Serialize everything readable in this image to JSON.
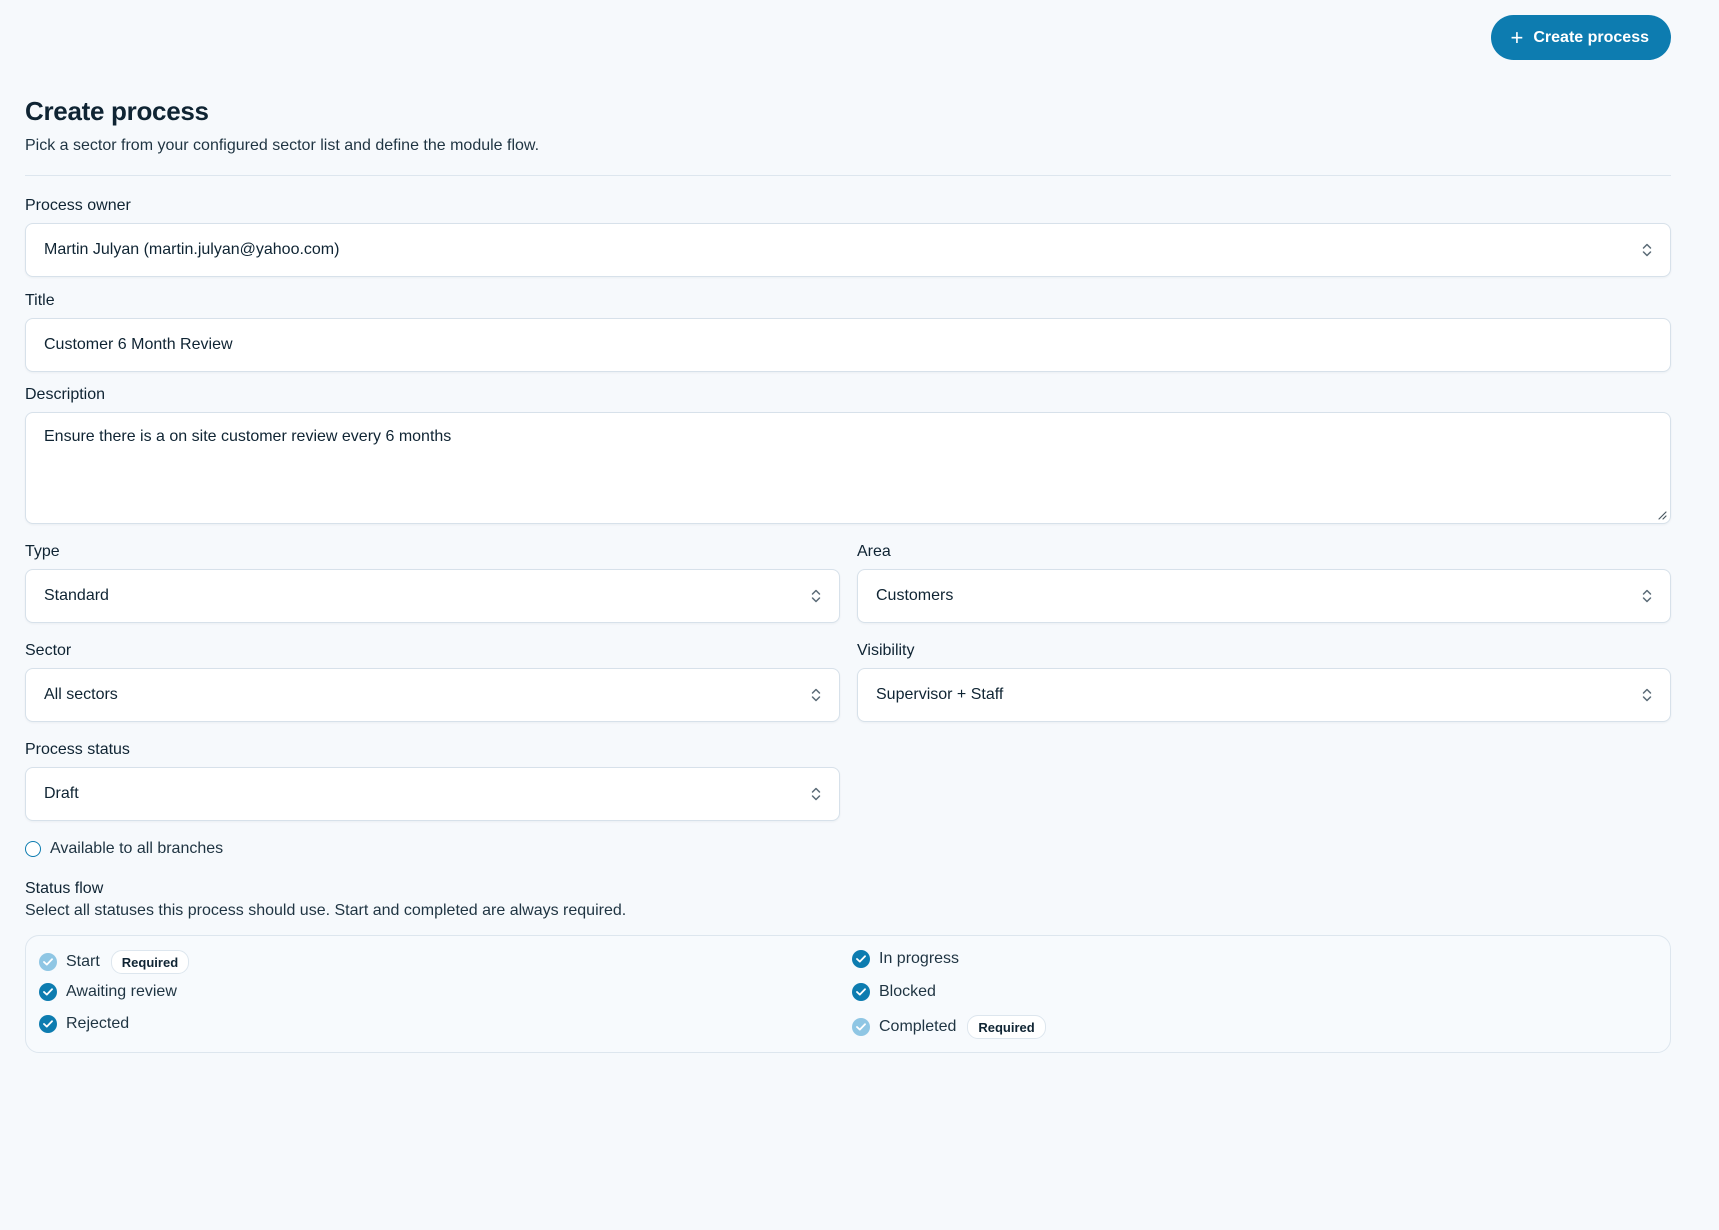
{
  "header": {
    "create_button_label": "Create process"
  },
  "page": {
    "title": "Create process",
    "subtitle": "Pick a sector from your configured sector list and define the module flow."
  },
  "form": {
    "process_owner": {
      "label": "Process owner",
      "value": "Martin Julyan (martin.julyan@yahoo.com)"
    },
    "title": {
      "label": "Title",
      "value": "Customer 6 Month Review"
    },
    "description": {
      "label": "Description",
      "value": "Ensure there is a on site customer review every 6 months"
    },
    "type": {
      "label": "Type",
      "value": "Standard"
    },
    "area": {
      "label": "Area",
      "value": "Customers"
    },
    "sector": {
      "label": "Sector",
      "value": "All sectors"
    },
    "visibility": {
      "label": "Visibility",
      "value": "Supervisor + Staff"
    },
    "process_status": {
      "label": "Process status",
      "value": "Draft"
    },
    "all_branches": {
      "label": "Available to all branches",
      "checked": false
    }
  },
  "status_flow": {
    "title": "Status flow",
    "description": "Select all statuses this process should use. Start and completed are always required.",
    "required_badge": "Required",
    "items": [
      {
        "label": "Start",
        "checked": true,
        "required": true
      },
      {
        "label": "In progress",
        "checked": true,
        "required": false
      },
      {
        "label": "Awaiting review",
        "checked": true,
        "required": false
      },
      {
        "label": "Blocked",
        "checked": true,
        "required": false
      },
      {
        "label": "Rejected",
        "checked": true,
        "required": false
      },
      {
        "label": "Completed",
        "checked": true,
        "required": true
      }
    ]
  },
  "icons": {
    "create": "plus-icon",
    "select": "chevron-up-down-icon",
    "check": "check-circle-icon"
  },
  "colors": {
    "accent": "#0d7cb0",
    "required_check": "#8fc6e4",
    "background": "#f6f9fc"
  }
}
